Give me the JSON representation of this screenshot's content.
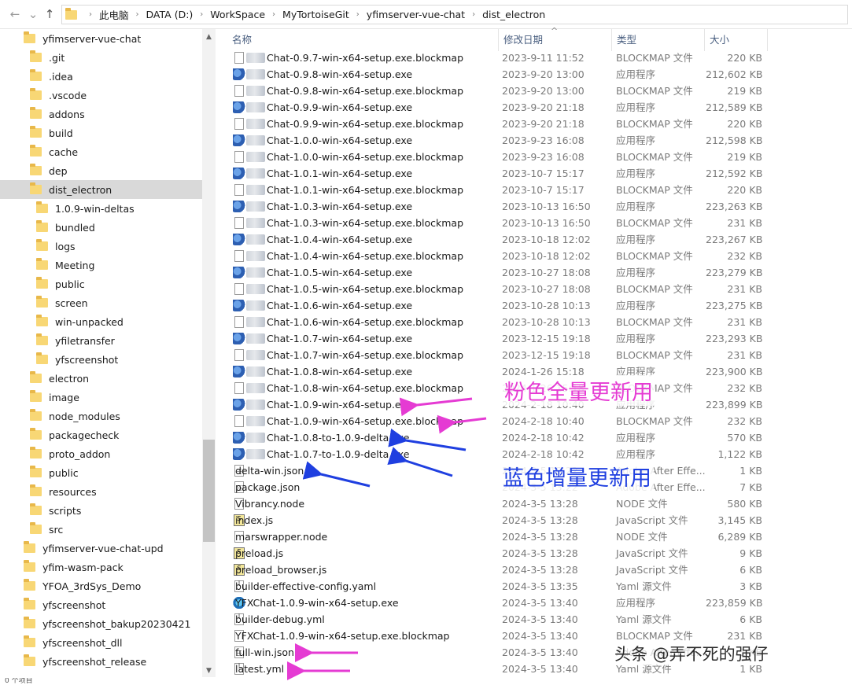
{
  "address": {
    "crumbs": [
      "此电脑",
      "DATA (D:)",
      "WorkSpace",
      "MyTortoiseGit",
      "yfimserver-vue-chat",
      "dist_electron"
    ]
  },
  "tree": {
    "items": [
      {
        "label": "yfimserver-vue-chat",
        "level": 0
      },
      {
        "label": ".git",
        "level": 1
      },
      {
        "label": ".idea",
        "level": 1
      },
      {
        "label": ".vscode",
        "level": 1
      },
      {
        "label": "addons",
        "level": 1
      },
      {
        "label": "build",
        "level": 1
      },
      {
        "label": "cache",
        "level": 1
      },
      {
        "label": "dep",
        "level": 1
      },
      {
        "label": "dist_electron",
        "level": 1,
        "selected": true
      },
      {
        "label": "1.0.9-win-deltas",
        "level": 2
      },
      {
        "label": "bundled",
        "level": 2
      },
      {
        "label": "logs",
        "level": 2
      },
      {
        "label": "Meeting",
        "level": 2
      },
      {
        "label": "public",
        "level": 2
      },
      {
        "label": "screen",
        "level": 2
      },
      {
        "label": "win-unpacked",
        "level": 2
      },
      {
        "label": "yfiletransfer",
        "level": 2
      },
      {
        "label": "yfscreenshot",
        "level": 2
      },
      {
        "label": "electron",
        "level": 1
      },
      {
        "label": "image",
        "level": 1
      },
      {
        "label": "node_modules",
        "level": 1
      },
      {
        "label": "packagecheck",
        "level": 1
      },
      {
        "label": "proto_addon",
        "level": 1
      },
      {
        "label": "public",
        "level": 1
      },
      {
        "label": "resources",
        "level": 1
      },
      {
        "label": "scripts",
        "level": 1
      },
      {
        "label": "src",
        "level": 1
      },
      {
        "label": "yfimserver-vue-chat-upd",
        "level": 0
      },
      {
        "label": "yfim-wasm-pack",
        "level": 0
      },
      {
        "label": "YFOA_3rdSys_Demo",
        "level": 0
      },
      {
        "label": "yfscreenshot",
        "level": 0
      },
      {
        "label": "yfscreenshot_bakup20230421",
        "level": 0
      },
      {
        "label": "yfscreenshot_dll",
        "level": 0
      },
      {
        "label": "yfscreenshot_release",
        "level": 0
      }
    ]
  },
  "columns": {
    "name": "名称",
    "date": "修改日期",
    "type": "类型",
    "size": "大小"
  },
  "files": [
    {
      "name": "Chat-0.9.7-win-x64-setup.exe.blockmap",
      "date": "2023-9-11 11:52",
      "type": "BLOCKMAP 文件",
      "size": "220 KB",
      "icon": "blank",
      "sens": true
    },
    {
      "name": "Chat-0.9.8-win-x64-setup.exe",
      "date": "2023-9-20 13:00",
      "type": "应用程序",
      "size": "212,602 KB",
      "icon": "exe",
      "sens": true
    },
    {
      "name": "Chat-0.9.8-win-x64-setup.exe.blockmap",
      "date": "2023-9-20 13:00",
      "type": "BLOCKMAP 文件",
      "size": "219 KB",
      "icon": "blank",
      "sens": true
    },
    {
      "name": "Chat-0.9.9-win-x64-setup.exe",
      "date": "2023-9-20 21:18",
      "type": "应用程序",
      "size": "212,589 KB",
      "icon": "exe",
      "sens": true
    },
    {
      "name": "Chat-0.9.9-win-x64-setup.exe.blockmap",
      "date": "2023-9-20 21:18",
      "type": "BLOCKMAP 文件",
      "size": "220 KB",
      "icon": "blank",
      "sens": true
    },
    {
      "name": "Chat-1.0.0-win-x64-setup.exe",
      "date": "2023-9-23 16:08",
      "type": "应用程序",
      "size": "212,598 KB",
      "icon": "exe",
      "sens": true
    },
    {
      "name": "Chat-1.0.0-win-x64-setup.exe.blockmap",
      "date": "2023-9-23 16:08",
      "type": "BLOCKMAP 文件",
      "size": "219 KB",
      "icon": "blank",
      "sens": true
    },
    {
      "name": "Chat-1.0.1-win-x64-setup.exe",
      "date": "2023-10-7 15:17",
      "type": "应用程序",
      "size": "212,592 KB",
      "icon": "exe",
      "sens": true
    },
    {
      "name": "Chat-1.0.1-win-x64-setup.exe.blockmap",
      "date": "2023-10-7 15:17",
      "type": "BLOCKMAP 文件",
      "size": "220 KB",
      "icon": "blank",
      "sens": true
    },
    {
      "name": "Chat-1.0.3-win-x64-setup.exe",
      "date": "2023-10-13 16:50",
      "type": "应用程序",
      "size": "223,263 KB",
      "icon": "exe",
      "sens": true
    },
    {
      "name": "Chat-1.0.3-win-x64-setup.exe.blockmap",
      "date": "2023-10-13 16:50",
      "type": "BLOCKMAP 文件",
      "size": "231 KB",
      "icon": "blank",
      "sens": true
    },
    {
      "name": "Chat-1.0.4-win-x64-setup.exe",
      "date": "2023-10-18 12:02",
      "type": "应用程序",
      "size": "223,267 KB",
      "icon": "exe",
      "sens": true
    },
    {
      "name": "Chat-1.0.4-win-x64-setup.exe.blockmap",
      "date": "2023-10-18 12:02",
      "type": "BLOCKMAP 文件",
      "size": "232 KB",
      "icon": "blank",
      "sens": true
    },
    {
      "name": "Chat-1.0.5-win-x64-setup.exe",
      "date": "2023-10-27 18:08",
      "type": "应用程序",
      "size": "223,279 KB",
      "icon": "exe",
      "sens": true
    },
    {
      "name": "Chat-1.0.5-win-x64-setup.exe.blockmap",
      "date": "2023-10-27 18:08",
      "type": "BLOCKMAP 文件",
      "size": "231 KB",
      "icon": "blank",
      "sens": true
    },
    {
      "name": "Chat-1.0.6-win-x64-setup.exe",
      "date": "2023-10-28 10:13",
      "type": "应用程序",
      "size": "223,275 KB",
      "icon": "exe",
      "sens": true
    },
    {
      "name": "Chat-1.0.6-win-x64-setup.exe.blockmap",
      "date": "2023-10-28 10:13",
      "type": "BLOCKMAP 文件",
      "size": "231 KB",
      "icon": "blank",
      "sens": true
    },
    {
      "name": "Chat-1.0.7-win-x64-setup.exe",
      "date": "2023-12-15 19:18",
      "type": "应用程序",
      "size": "223,293 KB",
      "icon": "exe",
      "sens": true
    },
    {
      "name": "Chat-1.0.7-win-x64-setup.exe.blockmap",
      "date": "2023-12-15 19:18",
      "type": "BLOCKMAP 文件",
      "size": "231 KB",
      "icon": "blank",
      "sens": true
    },
    {
      "name": "Chat-1.0.8-win-x64-setup.exe",
      "date": "2024-1-26 15:18",
      "type": "应用程序",
      "size": "223,900 KB",
      "icon": "exe",
      "sens": true
    },
    {
      "name": "Chat-1.0.8-win-x64-setup.exe.blockmap",
      "date": "2024-1-26 15:18",
      "type": "BLOCKMAP 文件",
      "size": "232 KB",
      "icon": "blank",
      "sens": true
    },
    {
      "name": "Chat-1.0.9-win-x64-setup.exe",
      "date": "2024-2-18 10:40",
      "type": "应用程序",
      "size": "223,899 KB",
      "icon": "exe",
      "sens": true
    },
    {
      "name": "Chat-1.0.9-win-x64-setup.exe.blockmap",
      "date": "2024-2-18 10:40",
      "type": "BLOCKMAP 文件",
      "size": "232 KB",
      "icon": "blank",
      "sens": true
    },
    {
      "name": "Chat-1.0.8-to-1.0.9-delta.exe",
      "date": "2024-2-18 10:42",
      "type": "应用程序",
      "size": "570 KB",
      "icon": "exe",
      "sens": true
    },
    {
      "name": "Chat-1.0.7-to-1.0.9-delta.exe",
      "date": "2024-2-18 10:42",
      "type": "应用程序",
      "size": "1,122 KB",
      "icon": "exe",
      "sens": true
    },
    {
      "name": "delta-win.json",
      "date": "2024-3-5 13:22",
      "type": "Adobe After Effe...",
      "size": "1 KB",
      "icon": "doc",
      "sens": false
    },
    {
      "name": "package.json",
      "date": "2024-3-5 13:22",
      "type": "Adobe After Effe...",
      "size": "7 KB",
      "icon": "doc",
      "sens": false
    },
    {
      "name": "Vibrancy.node",
      "date": "2024-3-5 13:28",
      "type": "NODE 文件",
      "size": "580 KB",
      "icon": "blank",
      "sens": false
    },
    {
      "name": "index.js",
      "date": "2024-3-5 13:28",
      "type": "JavaScript 文件",
      "size": "3,145 KB",
      "icon": "js",
      "sens": false
    },
    {
      "name": "marswrapper.node",
      "date": "2024-3-5 13:28",
      "type": "NODE 文件",
      "size": "6,289 KB",
      "icon": "blank",
      "sens": false
    },
    {
      "name": "preload.js",
      "date": "2024-3-5 13:28",
      "type": "JavaScript 文件",
      "size": "9 KB",
      "icon": "js",
      "sens": false
    },
    {
      "name": "preload_browser.js",
      "date": "2024-3-5 13:28",
      "type": "JavaScript 文件",
      "size": "6 KB",
      "icon": "js",
      "sens": false
    },
    {
      "name": "builder-effective-config.yaml",
      "date": "2024-3-5 13:35",
      "type": "Yaml 源文件",
      "size": "3 KB",
      "icon": "yaml",
      "sens": false
    },
    {
      "name": "YFXChat-1.0.9-win-x64-setup.exe",
      "date": "2024-3-5 13:40",
      "type": "应用程序",
      "size": "223,859 KB",
      "icon": "exe2",
      "sens": false
    },
    {
      "name": "builder-debug.yml",
      "date": "2024-3-5 13:40",
      "type": "Yaml 源文件",
      "size": "6 KB",
      "icon": "yaml",
      "sens": false
    },
    {
      "name": "YFXChat-1.0.9-win-x64-setup.exe.blockmap",
      "date": "2024-3-5 13:40",
      "type": "BLOCKMAP 文件",
      "size": "231 KB",
      "icon": "blank",
      "sens": false
    },
    {
      "name": "full-win.json",
      "date": "2024-3-5 13:40",
      "type": "Adobe After Effe...",
      "size": "1 KB",
      "icon": "doc",
      "sens": false
    },
    {
      "name": "latest.yml",
      "date": "2024-3-5 13:40",
      "type": "Yaml 源文件",
      "size": "1 KB",
      "icon": "yaml",
      "sens": false
    }
  ],
  "annotations": {
    "pink": "粉色全量更新用",
    "blue": "蓝色增量更新用",
    "pink_color": "#e53bd3",
    "blue_color": "#1f3fe0"
  },
  "watermark": "头条 @弄不死的强仔",
  "status": "0 个项目"
}
